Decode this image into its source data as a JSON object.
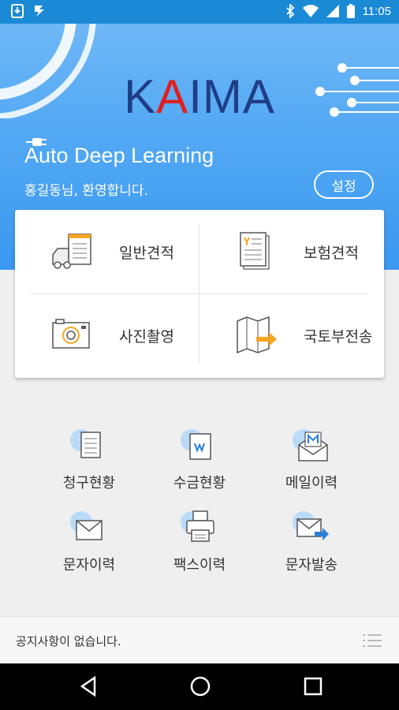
{
  "status_bar": {
    "time": "11:05"
  },
  "hero": {
    "logo_prefix": "K",
    "logo_accent": "A",
    "logo_suffix": "IMA",
    "title": "Auto Deep Learning",
    "greeting": "홍길동님, 환영합니다.",
    "settings_label": "설정"
  },
  "main_menu": {
    "general_estimate": "일반견적",
    "insurance_estimate": "보험견적",
    "photo": "사진촬영",
    "molit_transfer": "국토부전송"
  },
  "history_menu": {
    "billing_status": "청구현황",
    "collection_status": "수금현황",
    "mail_history": "메일이력",
    "sms_history": "문자이력",
    "fax_history": "팩스이력",
    "send_sms": "문자발송"
  },
  "notice": {
    "text": "공지사항이 없습니다."
  },
  "colors": {
    "status_bar": "#1a8ad7",
    "hero_top": "#6fb7f6",
    "hero_bottom": "#3a98f0",
    "logo_blue": "#1f3e86",
    "logo_red": "#e02020",
    "accent_orange": "#f5a623"
  }
}
